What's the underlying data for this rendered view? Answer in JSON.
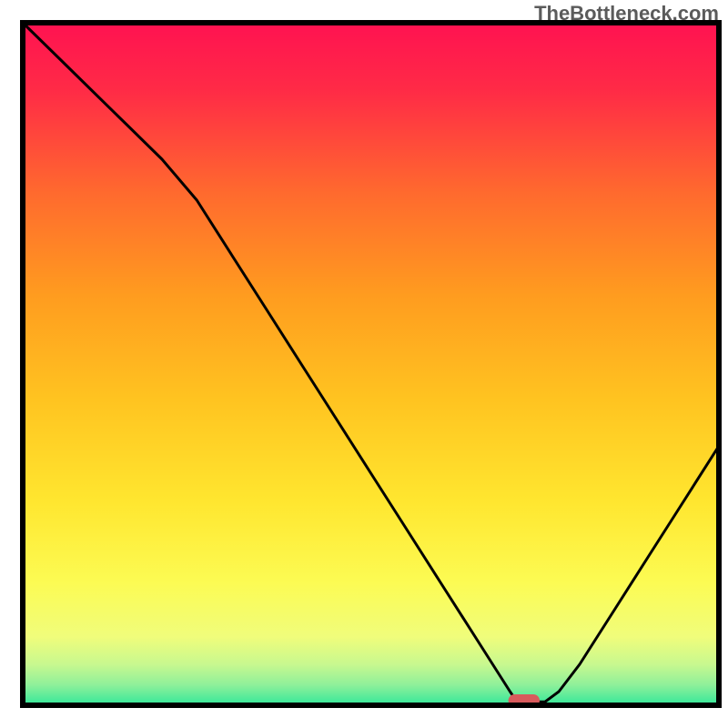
{
  "watermark": "TheBottleneck.com",
  "chart_data": {
    "type": "line",
    "title": "",
    "xlabel": "",
    "ylabel": "",
    "xlim": [
      0,
      100
    ],
    "ylim": [
      0,
      100
    ],
    "x": [
      0,
      5,
      10,
      15,
      20,
      25,
      30,
      35,
      40,
      45,
      50,
      55,
      60,
      65,
      70,
      71,
      73,
      75,
      77,
      80,
      85,
      90,
      95,
      100
    ],
    "values": [
      100,
      95,
      90,
      85,
      80,
      74,
      66,
      58,
      50,
      42,
      34,
      26,
      18,
      10,
      2,
      0.5,
      0.5,
      0.5,
      2,
      6,
      14,
      22,
      30,
      38
    ],
    "optimum_marker": {
      "x_center": 72,
      "y_center": 0.7,
      "width": 4.5,
      "height": 1.8
    },
    "colors": {
      "gradient_top": "#ff1251",
      "gradient_bottom": "#34e79a",
      "curve": "#000000",
      "marker": "#d85a5c"
    }
  }
}
